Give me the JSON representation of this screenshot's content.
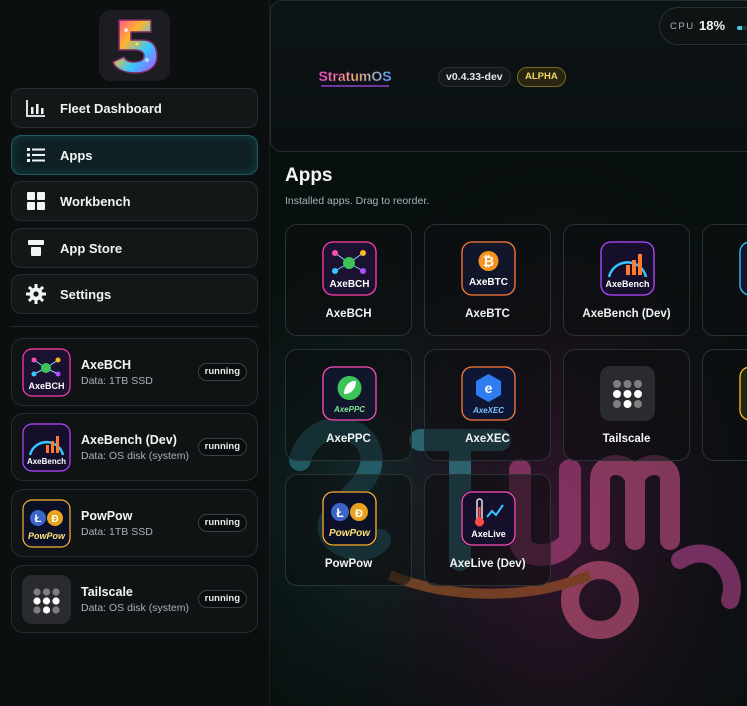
{
  "sidebar": {
    "logo_icon": "stratumos-5-logo",
    "nav": [
      {
        "label": "Fleet Dashboard",
        "icon": "bar-chart-icon"
      },
      {
        "label": "Apps",
        "icon": "list-icon",
        "active": true
      },
      {
        "label": "Workbench",
        "icon": "grid-icon"
      },
      {
        "label": "App Store",
        "icon": "store-icon"
      },
      {
        "label": "Settings",
        "icon": "gear-icon"
      }
    ],
    "running": [
      {
        "name": "AxeBCH",
        "sub": "Data: 1TB SSD",
        "status": "running"
      },
      {
        "name": "AxeBench (Dev)",
        "sub": "Data: OS disk (system)",
        "status": "running"
      },
      {
        "name": "PowPow",
        "sub": "Data: 1TB SSD",
        "status": "running"
      },
      {
        "name": "Tailscale",
        "sub": "Data: OS disk (system)",
        "status": "running"
      }
    ]
  },
  "header": {
    "brand": "StratumOS",
    "version": "v0.4.33-dev",
    "stage": "ALPHA",
    "cpu_label": "CPU",
    "cpu_value": "18%",
    "cpu_fraction": 0.18
  },
  "main": {
    "title": "Apps",
    "subtitle": "Installed apps. Drag to reorder.",
    "apps": [
      {
        "label": "AxeBCH",
        "icon": "axebch-icon"
      },
      {
        "label": "AxeBTC",
        "icon": "axebtc-icon"
      },
      {
        "label": "AxeBench (Dev)",
        "icon": "axebench-icon"
      },
      {
        "label": "AxePPC",
        "icon": "axeppc-icon"
      },
      {
        "label": "AxeXEC",
        "icon": "axexec-icon"
      },
      {
        "label": "Tailscale",
        "icon": "tailscale-icon"
      },
      {
        "label": "PowPow",
        "icon": "powpow-icon"
      },
      {
        "label": "AxeLive (Dev)",
        "icon": "axelive-icon"
      }
    ]
  },
  "colors": {
    "accent": "#4fc7d8",
    "alpha": "#f2d767",
    "background": "#07090a"
  }
}
